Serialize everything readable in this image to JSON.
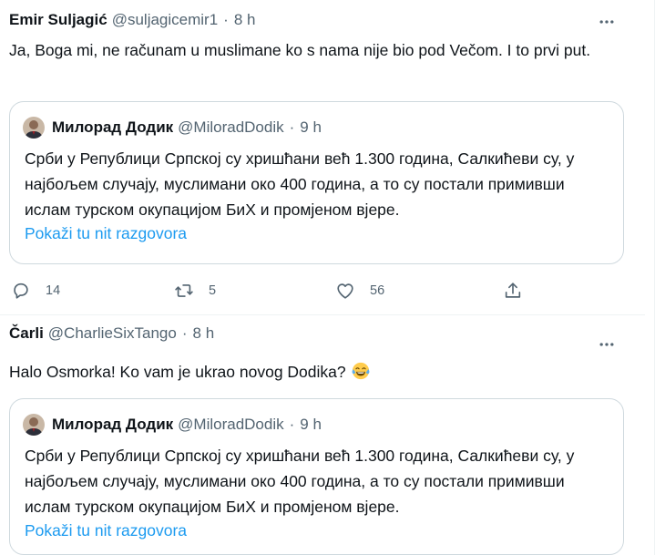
{
  "tweets": [
    {
      "author": {
        "name": "Emir Suljagić",
        "handle": "@suljagicemir1"
      },
      "separator": "·",
      "time": "8 h",
      "text": "Ja, Boga mi, ne računam u muslimane ko s nama nije bio pod Večom. I to prvi put.",
      "quote": {
        "author": {
          "name": "Милорад Додик",
          "handle": "@MiloradDodik"
        },
        "separator": "·",
        "time": "9 h",
        "text": "Срби у Републици Српској су хришћани већ 1.300 година, Салкићеви су, у најбољем случају, муслимани око 400 година, а то су постали примивши ислам турском окупацијом БиХ и промјеном вјере.",
        "link": "Pokaži tu nit razgovora"
      },
      "actions": {
        "replies": "14",
        "retweets": "5",
        "likes": "56"
      }
    },
    {
      "author": {
        "name": "Čarli",
        "handle": "@CharlieSixTango"
      },
      "separator": "·",
      "time": "8 h",
      "text": "Halo Osmorka! Ko vam je ukrao novog Dodika?",
      "emoji": "face-with-tears-of-joy",
      "quote": {
        "author": {
          "name": "Милорад Додик",
          "handle": "@MiloradDodik"
        },
        "separator": "·",
        "time": "9 h",
        "text": "Срби у Републици Српској су хришћани већ 1.300 година, Салкићеви су, у најбољем случају, муслимани око 400 година, а то су постали примивши ислам турском окупацијом БиХ и промјеном вјере.",
        "link": "Pokaži tu nit razgovora"
      }
    }
  ],
  "icons": {
    "more": "more-horizontal-icon",
    "reply": "reply-icon",
    "retweet": "retweet-icon",
    "like": "heart-icon",
    "share": "share-icon"
  },
  "colors": {
    "text": "#0f1419",
    "secondary": "#536471",
    "link": "#1d9bf0",
    "border": "#cfd9de",
    "divider": "#eff3f4"
  }
}
